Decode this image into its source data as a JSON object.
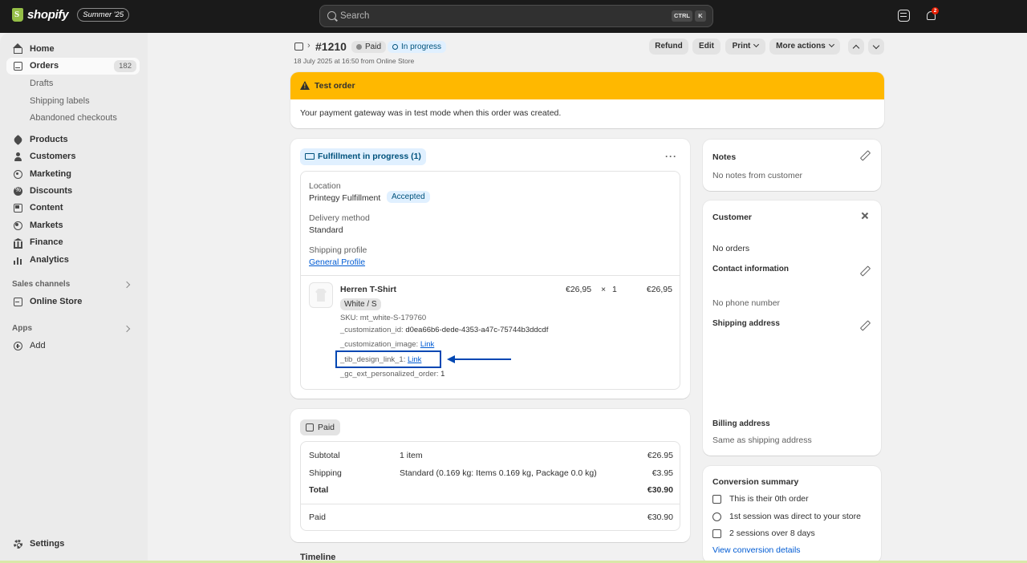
{
  "topbar": {
    "brand": "shopify",
    "edition": "Summer '25",
    "search_placeholder": "Search",
    "shortcut_ctrl": "CTRL",
    "shortcut_key": "K",
    "notification_count": "2"
  },
  "sidebar": {
    "items": [
      {
        "label": "Home",
        "icon": "home-icon"
      },
      {
        "label": "Orders",
        "icon": "orders-icon",
        "count": "182",
        "active": true
      },
      {
        "label": "Products",
        "icon": "tag-icon"
      },
      {
        "label": "Customers",
        "icon": "person-icon"
      },
      {
        "label": "Marketing",
        "icon": "target-icon"
      },
      {
        "label": "Discounts",
        "icon": "discount-icon"
      },
      {
        "label": "Content",
        "icon": "content-icon"
      },
      {
        "label": "Markets",
        "icon": "globe-icon"
      },
      {
        "label": "Finance",
        "icon": "bank-icon"
      },
      {
        "label": "Analytics",
        "icon": "bar-chart-icon"
      }
    ],
    "order_subitems": [
      "Drafts",
      "Shipping labels",
      "Abandoned checkouts"
    ],
    "sales_channels_label": "Sales channels",
    "online_store": "Online Store",
    "apps_label": "Apps",
    "add_label": "Add",
    "settings_label": "Settings"
  },
  "header": {
    "order_number": "#1210",
    "payment_status": "Paid",
    "fulfillment_status": "In progress",
    "meta": "18 July 2025 at 16:50 from Online Store",
    "refund": "Refund",
    "edit": "Edit",
    "print": "Print",
    "more_actions": "More actions"
  },
  "test_banner": {
    "title": "Test order",
    "message": "Your payment gateway was in test mode when this order was created."
  },
  "fulfillment": {
    "status": "Fulfillment in progress (1)",
    "location_label": "Location",
    "location": "Printegy Fulfillment",
    "location_badge": "Accepted",
    "delivery_label": "Delivery method",
    "delivery": "Standard",
    "profile_label": "Shipping profile",
    "profile": "General Profile",
    "item": {
      "name": "Herren T-Shirt",
      "variant": "White / S",
      "price": "€26,95",
      "times": "×",
      "qty": "1",
      "total": "€26,95",
      "sku": "SKU: mt_white-S-179760",
      "customization_id_key": "_customization_id:",
      "customization_id": "d0ea66b6-dede-4353-a47c-75744b3ddcdf",
      "customization_image_key": "_customization_image:",
      "customization_image_link": "Link",
      "tib_link_key": "_tib_design_link_1:",
      "tib_link": "Link",
      "gc_key": "_gc_ext_personalized_order:",
      "gc_value": "1"
    }
  },
  "payment": {
    "status": "Paid",
    "subtotal_label": "Subtotal",
    "subtotal_desc": "1 item",
    "subtotal": "€26.95",
    "shipping_label": "Shipping",
    "shipping_desc": "Standard (0.169 kg: Items 0.169 kg, Package 0.0 kg)",
    "shipping": "€3.95",
    "total_label": "Total",
    "total": "€30.90",
    "paid_label": "Paid",
    "paid": "€30.90"
  },
  "timeline_label": "Timeline",
  "notes": {
    "title": "Notes",
    "text": "No notes from customer"
  },
  "customer": {
    "title": "Customer",
    "orders": "No orders",
    "contact_label": "Contact information",
    "phone": "No phone number",
    "shipping_label": "Shipping address",
    "billing_label": "Billing address",
    "billing": "Same as shipping address"
  },
  "conversion": {
    "title": "Conversion summary",
    "rows": [
      "This is their 0th order",
      "1st session was direct to your store",
      "2 sessions over 8 days"
    ],
    "link": "View conversion details"
  }
}
